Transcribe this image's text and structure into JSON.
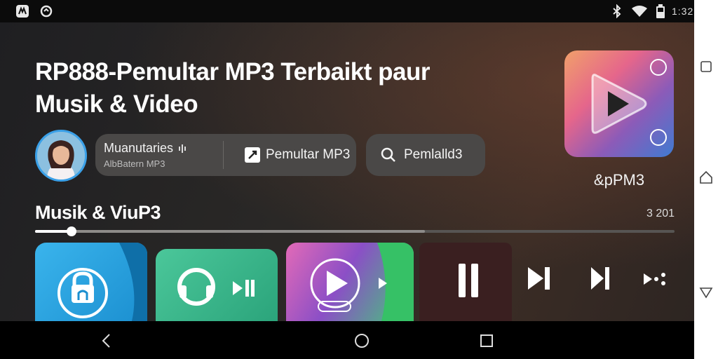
{
  "status_bar": {
    "time": "1:32",
    "left_icons": [
      "app-icon",
      "sync-icon"
    ],
    "right_icons": [
      "bluetooth-icon",
      "wifi-icon",
      "battery-icon"
    ]
  },
  "main": {
    "headline_line1": "RP888-Pemultar MP3 Terbaikt paur",
    "headline_line2": "Musik & Video",
    "user": {
      "name": "Muanutaries",
      "subtitle": "AlbBatern MP3"
    },
    "buttons": {
      "player_label": "Pemultar MP3",
      "search_label": "Pemlalld3"
    },
    "app_caption": "&pPM3",
    "section_title": "Musik & ViuP3",
    "section_meta": "3 201",
    "progress": {
      "played": 0.057,
      "buffered": 0.61
    }
  },
  "colors": {
    "accent": "#3aa0e8",
    "pill": "#4a4847",
    "card_blue": "#3ab4ec",
    "card_green": "#4bc79a",
    "card_purple": "#8b4fc6"
  },
  "system_nav": {
    "side": [
      "recents-icon",
      "home-icon",
      "back-icon"
    ],
    "bottom": [
      "back-icon",
      "home-icon",
      "recents-icon"
    ]
  }
}
